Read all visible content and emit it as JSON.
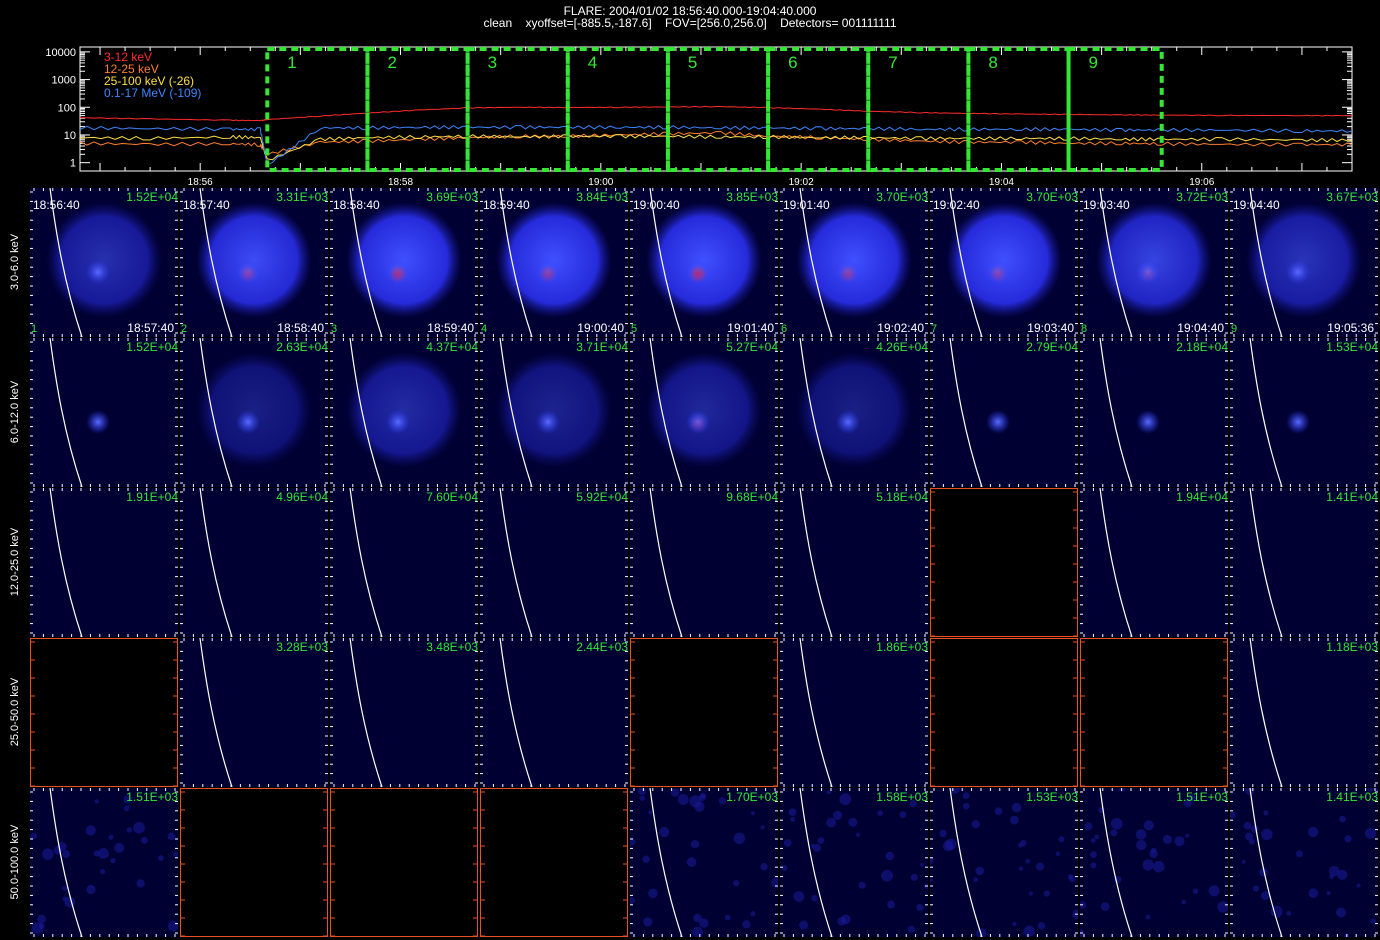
{
  "header": {
    "line1": "FLARE: 2004/01/02 18:56:40.000-19:04:40.000",
    "line2": "clean    xyoffset=[-885.5,-187.6]    FOV=[256.0,256.0]    Detectors= 001111111"
  },
  "colors": {
    "background": "#000000",
    "green": "#35e635",
    "ch1": "#ff2a2a",
    "ch2": "#ff7e30",
    "ch3": "#ffe04a",
    "ch4": "#3d86ff",
    "panel_bg": "#000033",
    "empty_frame": "#e8521f"
  },
  "legend": [
    {
      "label": "3-12 keV",
      "color": "#ff2a2a"
    },
    {
      "label": "12-25 keV",
      "color": "#ff7e30"
    },
    {
      "label": "25-100 keV (-26)",
      "color": "#ffe04a"
    },
    {
      "label": "0.1-17 MeV (-109)",
      "color": "#3d86ff"
    }
  ],
  "chart_data": {
    "type": "line",
    "x_ticks": [
      "18:56",
      "18:58",
      "19:00",
      "19:02",
      "19:04",
      "19:06"
    ],
    "x_tick_minutes": [
      56,
      58,
      60,
      62,
      64,
      66
    ],
    "xlim": [
      54.8,
      67.5
    ],
    "y_ticks": [
      "10000",
      "1000",
      "100",
      "10",
      "1"
    ],
    "y_tick_values": [
      10000,
      1000,
      100,
      10,
      1
    ],
    "ylim": [
      0.5,
      15000
    ],
    "y_scale": "log",
    "intervals": [
      {
        "label": "1",
        "start": 56.67,
        "end": 57.67
      },
      {
        "label": "2",
        "start": 57.67,
        "end": 58.67
      },
      {
        "label": "3",
        "start": 58.67,
        "end": 59.67
      },
      {
        "label": "4",
        "start": 59.67,
        "end": 60.67
      },
      {
        "label": "5",
        "start": 60.67,
        "end": 61.67
      },
      {
        "label": "6",
        "start": 61.67,
        "end": 62.67
      },
      {
        "label": "7",
        "start": 62.67,
        "end": 63.67
      },
      {
        "label": "8",
        "start": 63.67,
        "end": 64.67
      },
      {
        "label": "9",
        "start": 64.67,
        "end": 65.6
      }
    ],
    "series": [
      {
        "name": "3-12 keV",
        "x": [
          54.8,
          55.5,
          56.3,
          56.6,
          56.67,
          57.2,
          57.67,
          58.2,
          58.67,
          59.2,
          59.67,
          60.2,
          60.67,
          61.2,
          61.67,
          62.2,
          62.67,
          63.2,
          63.67,
          64.2,
          64.67,
          65.2,
          65.6,
          66.2,
          67.0,
          67.5
        ],
        "y": [
          42,
          38,
          34,
          33,
          36,
          48,
          62,
          80,
          95,
          100,
          98,
          100,
          103,
          105,
          97,
          85,
          72,
          64,
          60,
          57,
          55,
          53,
          52,
          51,
          50,
          50
        ]
      },
      {
        "name": "12-25 keV",
        "x": [
          54.8,
          55.5,
          56.3,
          56.6,
          56.67,
          57.2,
          57.67,
          58.2,
          58.67,
          59.2,
          59.67,
          60.2,
          60.67,
          61.2,
          61.67,
          62.2,
          62.67,
          63.2,
          63.67,
          64.2,
          64.67,
          65.2,
          65.6,
          66.2,
          67.0,
          67.5
        ],
        "y": [
          5,
          4.6,
          4.8,
          4.5,
          2.0,
          5.5,
          6,
          7,
          8,
          9,
          9,
          10,
          11,
          12,
          9,
          8,
          7,
          6,
          5.5,
          5.5,
          5,
          5,
          4.8,
          4.6,
          4.5,
          4.5
        ]
      },
      {
        "name": "25-100 keV (-26)",
        "x": [
          54.8,
          55.5,
          56.3,
          56.6,
          56.67,
          57.2,
          57.67,
          58.2,
          58.67,
          59.2,
          59.67,
          60.2,
          60.67,
          61.2,
          61.67,
          62.2,
          62.67,
          63.2,
          63.67,
          64.2,
          64.67,
          65.2,
          65.6,
          66.2,
          67.0,
          67.5
        ],
        "y": [
          8,
          7.5,
          8.5,
          8,
          1.2,
          7,
          8,
          8.5,
          9,
          8.5,
          9,
          9,
          9,
          8.5,
          8.5,
          8,
          8,
          7.5,
          7.5,
          7.5,
          7.5,
          7,
          7,
          7,
          6.5,
          6.5
        ]
      },
      {
        "name": "0.1-17 MeV (-109)",
        "x": [
          54.8,
          55.5,
          56.3,
          56.6,
          56.67,
          57.2,
          57.67,
          58.2,
          58.67,
          59.2,
          59.67,
          60.2,
          60.67,
          61.2,
          61.67,
          62.2,
          62.67,
          63.2,
          63.67,
          64.2,
          64.67,
          65.2,
          65.6,
          66.2,
          67.0,
          67.5
        ],
        "y": [
          18,
          17,
          16,
          16,
          0.8,
          18,
          18,
          19,
          19,
          19,
          19,
          19,
          19,
          18,
          18,
          17,
          17,
          16,
          16,
          16,
          16,
          15,
          15,
          15,
          14,
          14
        ]
      }
    ]
  },
  "image_grid": {
    "rows": [
      {
        "label": "3.0-6.0 keV",
        "panels": [
          {
            "max": "1.52E+04",
            "t_start": "18:56:40",
            "t_end": "18:57:40",
            "index": "1",
            "disk": 1,
            "brightness": 0.6,
            "red": 0.0,
            "empty": false
          },
          {
            "max": "3.31E+03",
            "t_start": "18:57:40",
            "t_end": "18:58:40",
            "index": "2",
            "disk": 1,
            "brightness": 0.95,
            "red": 0.5,
            "empty": false
          },
          {
            "max": "3.69E+03",
            "t_start": "18:58:40",
            "t_end": "18:59:40",
            "index": "3",
            "disk": 1,
            "brightness": 1.0,
            "red": 0.8,
            "empty": false
          },
          {
            "max": "3.84E+03",
            "t_start": "18:59:40",
            "t_end": "19:00:40",
            "index": "4",
            "disk": 1,
            "brightness": 1.0,
            "red": 0.6,
            "empty": false
          },
          {
            "max": "3.85E+03",
            "t_start": "19:00:40",
            "t_end": "19:01:40",
            "index": "5",
            "disk": 1,
            "brightness": 1.0,
            "red": 0.9,
            "empty": false
          },
          {
            "max": "3.70E+03",
            "t_start": "19:01:40",
            "t_end": "19:02:40",
            "index": "6",
            "disk": 1,
            "brightness": 1.0,
            "red": 0.6,
            "empty": false
          },
          {
            "max": "3.70E+03",
            "t_start": "19:02:40",
            "t_end": "19:03:40",
            "index": "7",
            "disk": 1,
            "brightness": 1.0,
            "red": 0.5,
            "empty": false
          },
          {
            "max": "3.72E+03",
            "t_start": "19:03:40",
            "t_end": "19:04:40",
            "index": "8",
            "disk": 1,
            "brightness": 0.85,
            "red": 0.3,
            "empty": false
          },
          {
            "max": "3.67E+03",
            "t_start": "19:04:40",
            "t_end": "19:05:36",
            "index": "9",
            "disk": 1,
            "brightness": 0.65,
            "red": 0.0,
            "empty": false
          }
        ]
      },
      {
        "label": "6.0-12.0 keV",
        "panels": [
          {
            "max": "1.52E+04",
            "disk": 0,
            "brightness": 0.5,
            "red": 0.0,
            "empty": false
          },
          {
            "max": "2.63E+04",
            "disk": 1,
            "brightness": 0.4,
            "red": 0.0,
            "empty": false
          },
          {
            "max": "4.37E+04",
            "disk": 1,
            "brightness": 0.55,
            "red": 0.0,
            "empty": false
          },
          {
            "max": "3.71E+04",
            "disk": 1,
            "brightness": 0.45,
            "red": 0.0,
            "empty": false
          },
          {
            "max": "5.27E+04",
            "disk": 1,
            "brightness": 0.5,
            "red": 0.3,
            "empty": false
          },
          {
            "max": "4.26E+04",
            "disk": 1,
            "brightness": 0.4,
            "red": 0.0,
            "empty": false
          },
          {
            "max": "2.79E+04",
            "disk": 0,
            "brightness": 0.5,
            "red": 0.0,
            "empty": false
          },
          {
            "max": "2.18E+04",
            "disk": 0,
            "brightness": 0.4,
            "red": 0.0,
            "empty": false
          },
          {
            "max": "1.53E+04",
            "disk": 0,
            "brightness": 0.2,
            "red": 0.0,
            "empty": false
          }
        ]
      },
      {
        "label": "12.0-25.0 keV",
        "panels": [
          {
            "max": "1.91E+04",
            "disk": 0,
            "brightness": 0,
            "red": 0,
            "empty": false
          },
          {
            "max": "4.96E+04",
            "disk": 0,
            "brightness": 0,
            "red": 0,
            "empty": false
          },
          {
            "max": "7.60E+04",
            "disk": 0,
            "brightness": 0,
            "red": 0,
            "empty": false
          },
          {
            "max": "5.92E+04",
            "disk": 0,
            "brightness": 0,
            "red": 0,
            "empty": false
          },
          {
            "max": "9.68E+04",
            "disk": 0,
            "brightness": 0,
            "red": 0,
            "empty": false
          },
          {
            "max": "5.18E+04",
            "disk": 0,
            "brightness": 0,
            "red": 0,
            "empty": false
          },
          {
            "max": "",
            "empty": true
          },
          {
            "max": "1.94E+04",
            "disk": 0,
            "brightness": 0,
            "red": 0,
            "empty": false
          },
          {
            "max": "1.41E+04",
            "disk": 0,
            "brightness": 0,
            "red": 0,
            "empty": false
          }
        ]
      },
      {
        "label": "25.0-50.0 keV",
        "panels": [
          {
            "max": "",
            "empty": true
          },
          {
            "max": "3.28E+03",
            "disk": 0,
            "brightness": 0,
            "red": 0,
            "empty": false
          },
          {
            "max": "3.48E+03",
            "disk": 0,
            "brightness": 0,
            "red": 0,
            "empty": false
          },
          {
            "max": "2.44E+03",
            "disk": 0,
            "brightness": 0,
            "red": 0,
            "empty": false
          },
          {
            "max": "",
            "empty": true
          },
          {
            "max": "1.86E+03",
            "disk": 0,
            "brightness": 0,
            "red": 0,
            "empty": false
          },
          {
            "max": "",
            "empty": true
          },
          {
            "max": "",
            "empty": true
          },
          {
            "max": "1.18E+03",
            "disk": 0,
            "brightness": 0,
            "red": 0,
            "empty": false
          }
        ]
      },
      {
        "label": "50.0-100.0 keV",
        "panels": [
          {
            "max": "1.51E+03",
            "disk": 0,
            "brightness": 0,
            "red": 0,
            "empty": false,
            "noise": true
          },
          {
            "max": "",
            "empty": true
          },
          {
            "max": "",
            "empty": true
          },
          {
            "max": "",
            "empty": true
          },
          {
            "max": "1.70E+03",
            "disk": 0,
            "brightness": 0,
            "red": 0,
            "empty": false,
            "noise": true
          },
          {
            "max": "1.58E+03",
            "disk": 0,
            "brightness": 0,
            "red": 0,
            "empty": false,
            "noise": true
          },
          {
            "max": "1.53E+03",
            "disk": 0,
            "brightness": 0,
            "red": 0,
            "empty": false,
            "noise": true
          },
          {
            "max": "1.51E+03",
            "disk": 0,
            "brightness": 0,
            "red": 0,
            "empty": false,
            "noise": true
          },
          {
            "max": "1.41E+03",
            "disk": 0,
            "brightness": 0,
            "red": 0,
            "empty": false,
            "noise": true
          }
        ]
      }
    ]
  }
}
